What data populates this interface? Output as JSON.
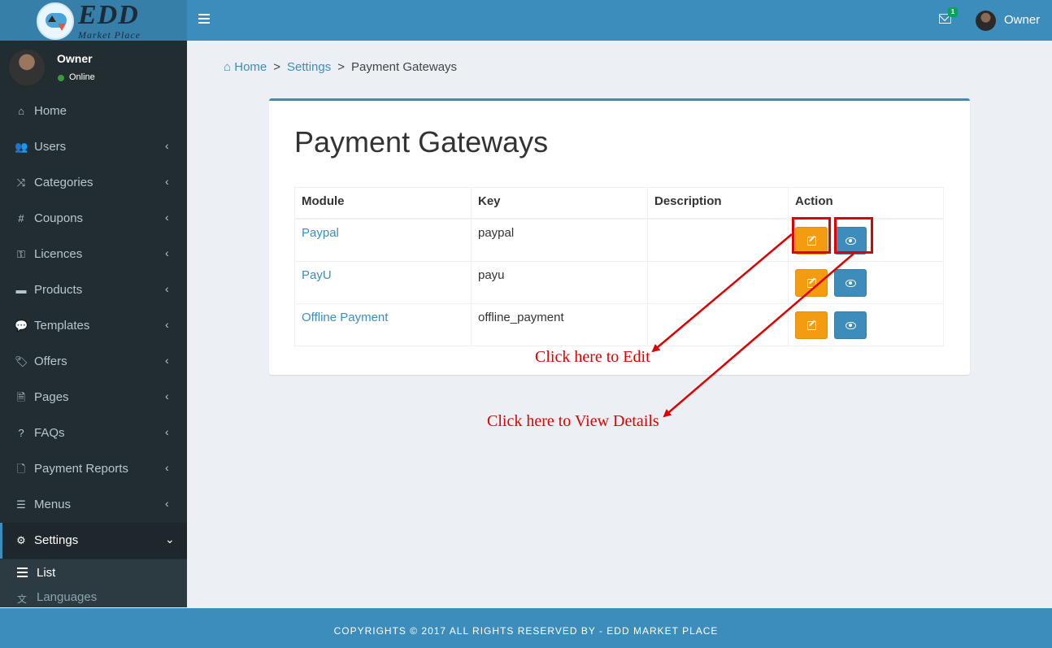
{
  "header": {
    "logo_title": "EDD",
    "logo_subtitle": "Market Place",
    "mail_count": "1",
    "user_name": "Owner"
  },
  "sidebar": {
    "user_name": "Owner",
    "status": "Online",
    "items": [
      {
        "label": "Home",
        "icon": "home-icon",
        "glyph": "⌂",
        "caret": ""
      },
      {
        "label": "Users",
        "icon": "users-icon",
        "glyph": "👥",
        "caret": "‹"
      },
      {
        "label": "Categories",
        "icon": "shuffle-icon",
        "glyph": "⤨",
        "caret": "‹"
      },
      {
        "label": "Coupons",
        "icon": "hashtag-icon",
        "glyph": "#",
        "caret": "‹"
      },
      {
        "label": "Licences",
        "icon": "key-icon",
        "glyph": "⚿",
        "caret": "‹"
      },
      {
        "label": "Products",
        "icon": "briefcase-icon",
        "glyph": "▬",
        "caret": "‹"
      },
      {
        "label": "Templates",
        "icon": "comments-icon",
        "glyph": "💬",
        "caret": "‹"
      },
      {
        "label": "Offers",
        "icon": "tags-icon",
        "glyph": "🏷",
        "caret": "‹"
      },
      {
        "label": "Pages",
        "icon": "file-text-icon",
        "glyph": "🗎",
        "caret": "‹"
      },
      {
        "label": "FAQs",
        "icon": "question-icon",
        "glyph": "?",
        "caret": "‹"
      },
      {
        "label": "Payment Reports",
        "icon": "file-icon",
        "glyph": "🗋",
        "caret": "‹"
      },
      {
        "label": "Menus",
        "icon": "bars-icon",
        "glyph": "☰",
        "caret": "‹"
      },
      {
        "label": "Settings",
        "icon": "gear-icon",
        "glyph": "⚙",
        "caret": "⌄"
      }
    ],
    "submenu": [
      {
        "label": "List",
        "icon": "list-icon"
      },
      {
        "label": "Languages",
        "icon": "language-icon",
        "glyph": "文"
      }
    ]
  },
  "breadcrumb": {
    "home": "Home",
    "settings": "Settings",
    "current": "Payment Gateways",
    "separator": ">"
  },
  "main": {
    "title": "Payment Gateways",
    "columns": [
      "Module",
      "Key",
      "Description",
      "Action"
    ],
    "rows": [
      {
        "module": "Paypal",
        "key": "paypal",
        "description": ""
      },
      {
        "module": "PayU",
        "key": "payu",
        "description": ""
      },
      {
        "module": "Offline Payment",
        "key": "offline_payment",
        "description": ""
      }
    ]
  },
  "annotations": {
    "edit": "Click here to Edit",
    "view": "Click here to View Details"
  },
  "footer": {
    "text": "COPYRIGHTS © 2017 ALL RIGHTS RESERVED BY - EDD MARKET PLACE"
  },
  "colors": {
    "primary": "#3c8dbc",
    "sidebar": "#222d32",
    "edit_button": "#f39c12",
    "annotation": "#e00000"
  }
}
